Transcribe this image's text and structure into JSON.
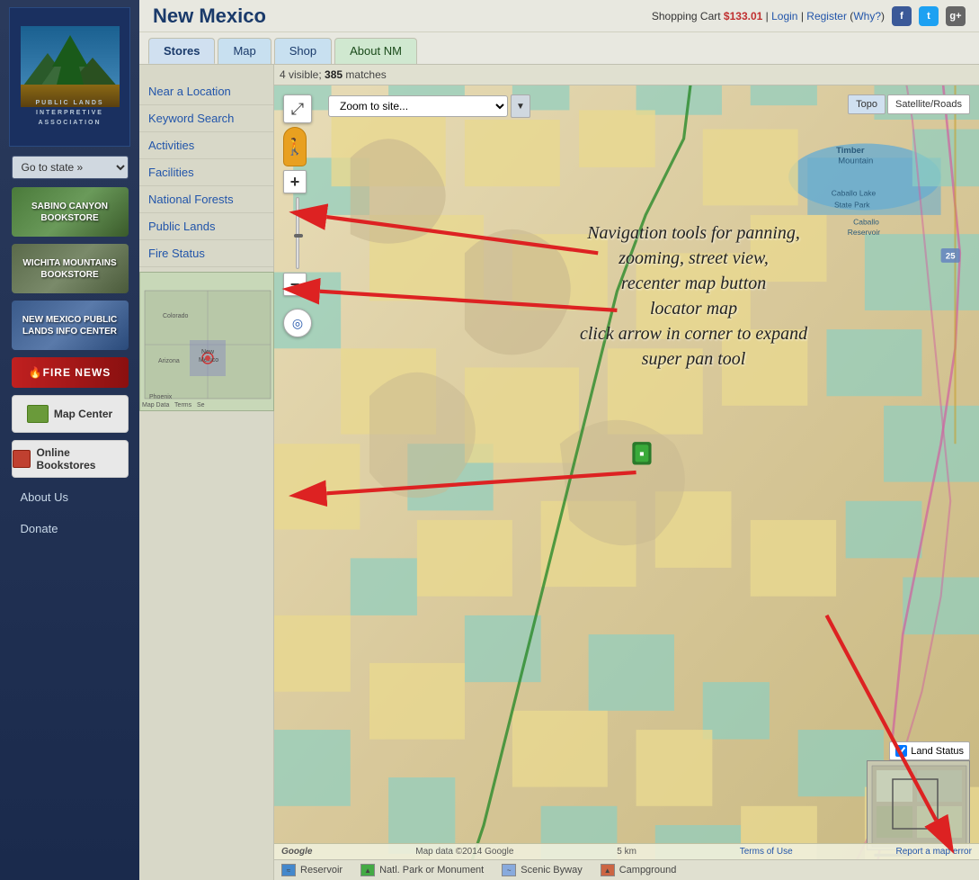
{
  "header": {
    "title": "New Mexico",
    "cart": {
      "label": "Shopping Cart",
      "amount": "$133.01",
      "login": "Login",
      "register": "Register",
      "why": "Why?"
    }
  },
  "tabs": [
    {
      "id": "stores",
      "label": "Stores",
      "active": true
    },
    {
      "id": "map",
      "label": "Map",
      "active": false
    },
    {
      "id": "shop",
      "label": "Shop",
      "active": false
    },
    {
      "id": "about",
      "label": "About NM",
      "active": false
    }
  ],
  "map": {
    "matches_text": "4 visible; ",
    "matches_count": "385",
    "matches_suffix": " matches",
    "zoom_placeholder": "Zoom to site...",
    "type_topo": "Topo",
    "type_satellite": "Satellite/Roads",
    "footer_data": "Map data ©2014 Google",
    "footer_scale": "5 km",
    "footer_terms": "Terms of Use",
    "footer_report": "Report a map error",
    "land_status": "Land Status",
    "google_label": "Google"
  },
  "filters": [
    {
      "label": "Near a Location"
    },
    {
      "label": "Keyword Search"
    },
    {
      "label": "Activities"
    },
    {
      "label": "Facilities"
    },
    {
      "label": "National Forests"
    },
    {
      "label": "Public Lands"
    },
    {
      "label": "Fire Status"
    }
  ],
  "sidebar": {
    "state_select": "Go to state »",
    "bookstores": [
      {
        "label": "SABINO CANYON BOOKSTORE",
        "class": "bookstore-sabino"
      },
      {
        "label": "WICHITA MOUNTAINS BOOKSTORE",
        "class": "bookstore-wichita"
      },
      {
        "label": "NEW MEXICO PUBLIC LANDS INFO CENTER",
        "class": "bookstore-nm"
      }
    ],
    "fire_news": "FIRE NEWS",
    "map_center": "Map Center",
    "online_bookstores": "Online Bookstores",
    "about_us": "About Us",
    "donate": "Donate"
  },
  "annotation": {
    "line1": "Navigation tools for panning,",
    "line2": "zooming, street view,",
    "line3": "recenter map button",
    "line4": "locator map",
    "line5": "click arrow in corner to expand",
    "line6": "super pan tool"
  },
  "legend": [
    {
      "icon": "reservoir",
      "label": "Reservoir"
    },
    {
      "icon": "park",
      "label": "Natl. Park or Monument"
    },
    {
      "icon": "byway",
      "label": "Scenic Byway"
    },
    {
      "icon": "campground",
      "label": "Campground"
    }
  ]
}
